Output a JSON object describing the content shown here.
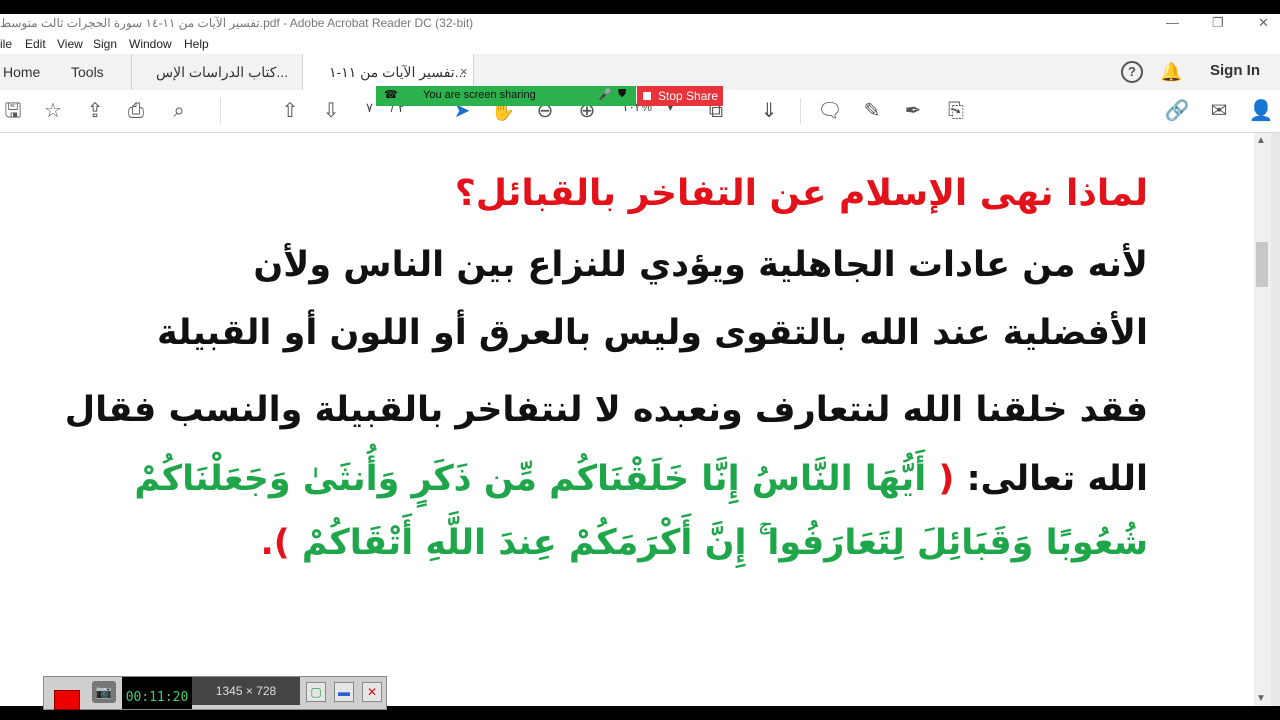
{
  "window": {
    "title": "تفسير الآيات من ١١-١٤ سورة الحجرات ثالث متوسط.pdf - Adobe Acrobat Reader DC (32-bit)"
  },
  "menu": [
    "ile",
    "Edit",
    "View",
    "Sign",
    "Window",
    "Help"
  ],
  "tabs": {
    "home": "Home",
    "tools": "Tools",
    "doc1": "كتاب الدراسات الإس...",
    "doc2": "تفسير الآيات من ١١-١...",
    "close": "×"
  },
  "header": {
    "sign_in": "Sign In",
    "help": "?"
  },
  "toolbar": {
    "page_current": "٢",
    "page_sep": "/",
    "page_total": "٧",
    "zoom": "١٠٢%"
  },
  "screen_share": {
    "message": "You are screen sharing",
    "stop_label": "Stop Share"
  },
  "document": {
    "heading": "لماذا نهى الإسلام عن التفاخر بالقبائل؟",
    "line1": "لأنه من عادات الجاهلية ويؤدي للنزاع بين الناس ولأن",
    "line2": "الأفضلية عند الله بالتقوى وليس بالعرق أو اللون أو القبيلة",
    "line3": "فقد خلقنا الله لنتعارف ونعبده لا لنتفاخر بالقبيلة والنسب فقال",
    "line4_prefix": "الله تعالى:",
    "open_paren": "(",
    "verse_part1": "أَيُّهَا النَّاسُ إِنَّا خَلَقْنَاكُم مِّن ذَكَرٍ وَأُنثَىٰ وَجَعَلْنَاكُمْ",
    "verse_part2": "شُعُوبًا وَقَبَائِلَ لِتَعَارَفُوا ۚ إِنَّ أَكْرَمَكُمْ عِندَ اللَّهِ أَتْقَاكُمْ",
    "close_paren": ").",
    "colors": {
      "heading": "#e3121a",
      "body": "#111111",
      "verse": "#1fa64a"
    }
  },
  "recorder": {
    "timer": "00:11:20",
    "dimensions": "1345 × 728"
  }
}
